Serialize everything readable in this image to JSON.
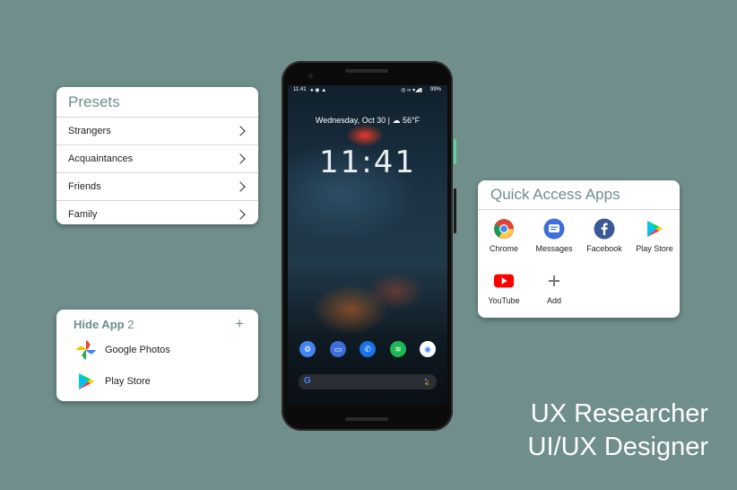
{
  "presets": {
    "title": "Presets",
    "items": [
      {
        "label": "Strangers"
      },
      {
        "label": "Acquaintances"
      },
      {
        "label": "Friends"
      },
      {
        "label": "Family"
      }
    ]
  },
  "hide_app": {
    "title": "Hide App",
    "count": "2",
    "add_symbol": "+",
    "apps": [
      {
        "label": "Google Photos",
        "icon": "google-photos-icon"
      },
      {
        "label": "Play Store",
        "icon": "play-store-icon"
      }
    ]
  },
  "quick_access": {
    "title": "Quick Access Apps",
    "apps": [
      {
        "label": "Chrome",
        "icon": "chrome-icon"
      },
      {
        "label": "Messages",
        "icon": "messages-icon"
      },
      {
        "label": "Facebook",
        "icon": "facebook-icon"
      },
      {
        "label": "Play Store",
        "icon": "play-store-icon"
      },
      {
        "label": "YouTube",
        "icon": "youtube-icon"
      },
      {
        "label": "Add",
        "icon": "plus-icon"
      }
    ]
  },
  "phone": {
    "status_time": "11:41",
    "battery": "99%",
    "date": "Wednesday, Oct 30",
    "weather": "56°F",
    "clock": "11:41",
    "search_logo": "G"
  },
  "roles": [
    "UX Researcher",
    "UI/UX Designer"
  ],
  "colors": {
    "accent": "#6f8e8c",
    "background": "#6f8e8c"
  }
}
